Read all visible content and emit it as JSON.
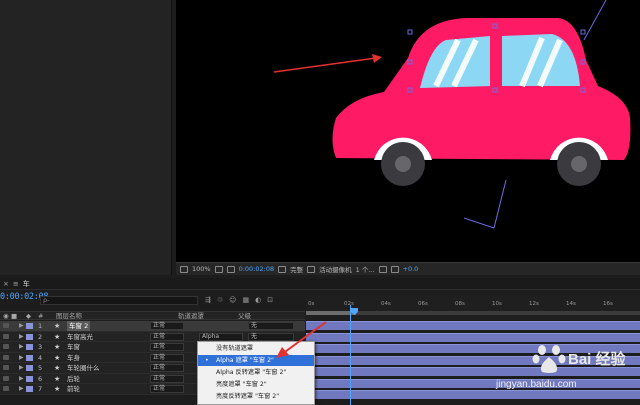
{
  "timeline": {
    "tab": "车",
    "time": "0:00:02:08",
    "search_placeholder": "ρ-",
    "columns": {
      "layer_name": "图层名称",
      "track_matte": "轨道遮罩",
      "parent": "父级"
    },
    "ruler_ticks": [
      "0s",
      "02s",
      "04s",
      "06s",
      "08s",
      "10s",
      "12s",
      "14s",
      "16s"
    ],
    "layers": [
      {
        "num": "1",
        "name": "车窗 2",
        "mode": "正常",
        "matte": "",
        "parent": "无",
        "selected": true
      },
      {
        "num": "2",
        "name": "车窗高光",
        "mode": "正常",
        "matte": "Alpha",
        "parent": "无"
      },
      {
        "num": "3",
        "name": "车窗",
        "mode": "正常",
        "matte": "",
        "parent": ""
      },
      {
        "num": "4",
        "name": "车身",
        "mode": "正常",
        "matte": "",
        "parent": ""
      },
      {
        "num": "5",
        "name": "车轮圈什么",
        "mode": "正常",
        "matte": "",
        "parent": ""
      },
      {
        "num": "6",
        "name": "后轮",
        "mode": "正常",
        "matte": "",
        "parent": ""
      },
      {
        "num": "7",
        "name": "前轮",
        "mode": "正常",
        "matte": "",
        "parent": ""
      }
    ]
  },
  "viewer_bar": {
    "zoom": "100%",
    "timecode": "0:00:02:08",
    "resolution": "完整",
    "camera": "活动摄像机",
    "views": "1 个...",
    "exposure": "+0.0"
  },
  "menu": {
    "items": [
      {
        "label": "没有轨道遮罩",
        "checked": false,
        "highlighted": false
      },
      {
        "label": "Alpha 遮罩 \"车窗 2\"",
        "checked": true,
        "highlighted": true
      },
      {
        "label": "Alpha 反转遮罩 \"车窗 2\"",
        "checked": false,
        "highlighted": false
      },
      {
        "label": "亮度遮罩 \"车窗 2\"",
        "checked": false,
        "highlighted": false
      },
      {
        "label": "亮度反转遮罩 \"车窗 2\"",
        "checked": false,
        "highlighted": false
      }
    ]
  },
  "watermark": {
    "brand": "Bai 经验",
    "url": "jingyan.baidu.com"
  },
  "colors": {
    "car_body": "#ff1a66",
    "window": "#8cd8f4",
    "accent_blue": "#4ea6ff",
    "track_bar": "#7079c0",
    "menu_highlight": "#2f71d8"
  }
}
